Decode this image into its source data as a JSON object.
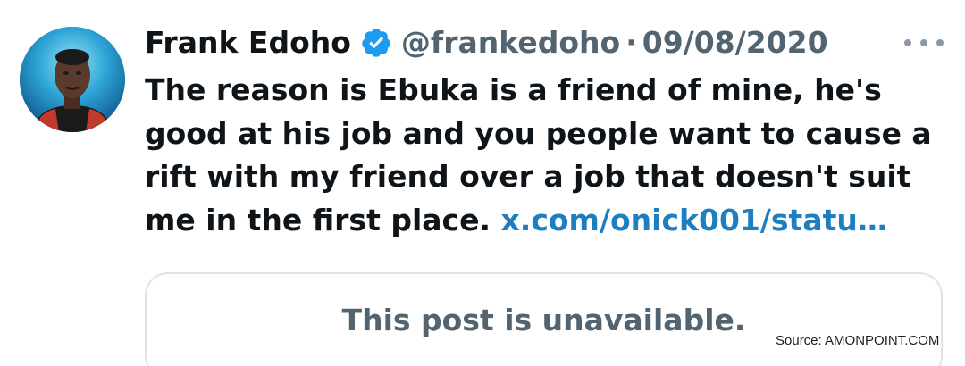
{
  "tweet": {
    "author_name": "Frank Edoho",
    "handle": "@frankedoho",
    "separator": "·",
    "date": "09/08/2020",
    "verified_icon": "verified-badge-icon",
    "more_icon": "more-dots-icon",
    "text_main": "The reason is Ebuka is a friend of mine, he's good at his job and you people want to cause a rift with my friend over a job that doesn't suit me in the first place. ",
    "link_text": "x.com/onick001/statu…",
    "quoted_post": {
      "unavailable_text": "This post is unavailable."
    }
  },
  "watermark": {
    "text": "Source: AMONPOINT.COM"
  },
  "colors": {
    "text": "#0f1419",
    "secondary": "#536471",
    "link": "#1d7fbf",
    "verified": "#1d9bf0",
    "border": "#dfe4e8"
  }
}
